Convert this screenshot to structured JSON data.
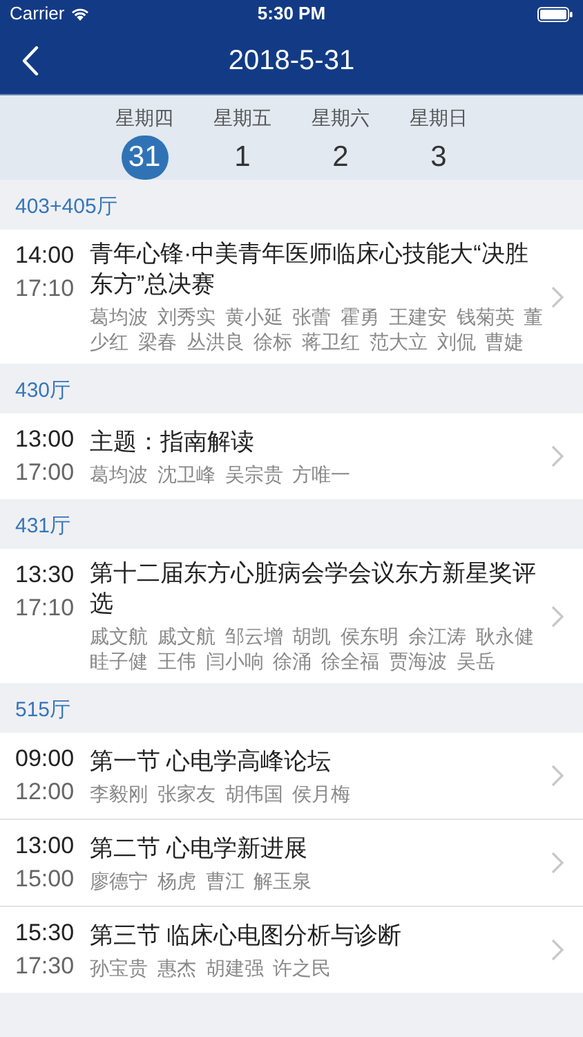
{
  "status_bar": {
    "carrier": "Carrier",
    "time": "5:30 PM"
  },
  "nav": {
    "title": "2018-5-31"
  },
  "days": [
    {
      "weekday": "星期四",
      "date": "31",
      "selected": true
    },
    {
      "weekday": "星期五",
      "date": "1",
      "selected": false
    },
    {
      "weekday": "星期六",
      "date": "2",
      "selected": false
    },
    {
      "weekday": "星期日",
      "date": "3",
      "selected": false
    }
  ],
  "sections": [
    {
      "hall": "403+405厅",
      "sessions": [
        {
          "start": "14:00",
          "end": "17:10",
          "title": "青年心锋·中美青年医师临床心技能大“决胜东方”总决赛",
          "speaker_lines": [
            "葛均波 刘秀实 黄小延 张蕾 霍勇 王建安 钱菊英 董",
            "少红 梁春 丛洪良 徐标 蒋卫红 范大立 刘侃 曹婕"
          ]
        }
      ]
    },
    {
      "hall": "430厅",
      "sessions": [
        {
          "start": "13:00",
          "end": "17:00",
          "title": "主题：指南解读",
          "speaker_lines": [
            "葛均波 沈卫峰 吴宗贵 方唯一"
          ]
        }
      ]
    },
    {
      "hall": "431厅",
      "sessions": [
        {
          "start": "13:30",
          "end": "17:10",
          "title": "第十二届东方心脏病会学会议东方新星奖评选",
          "speaker_lines": [
            "戚文航 戚文航 邹云增 胡凯 侯东明 余江涛 耿永健",
            "眭子健 王伟 闫小响 徐涌 徐全福 贾海波 吴岳"
          ]
        }
      ]
    },
    {
      "hall": "515厅",
      "sessions": [
        {
          "start": "09:00",
          "end": "12:00",
          "title": "第一节 心电学高峰论坛",
          "speaker_lines": [
            "李毅刚 张家友 胡伟国 侯月梅"
          ]
        },
        {
          "start": "13:00",
          "end": "15:00",
          "title": "第二节 心电学新进展",
          "speaker_lines": [
            "廖德宁 杨虎 曹江 解玉泉"
          ]
        },
        {
          "start": "15:30",
          "end": "17:30",
          "title": "第三节 临床心电图分析与诊断",
          "speaker_lines": [
            "孙宝贵 惠杰 胡建强 许之民"
          ]
        }
      ]
    }
  ]
}
